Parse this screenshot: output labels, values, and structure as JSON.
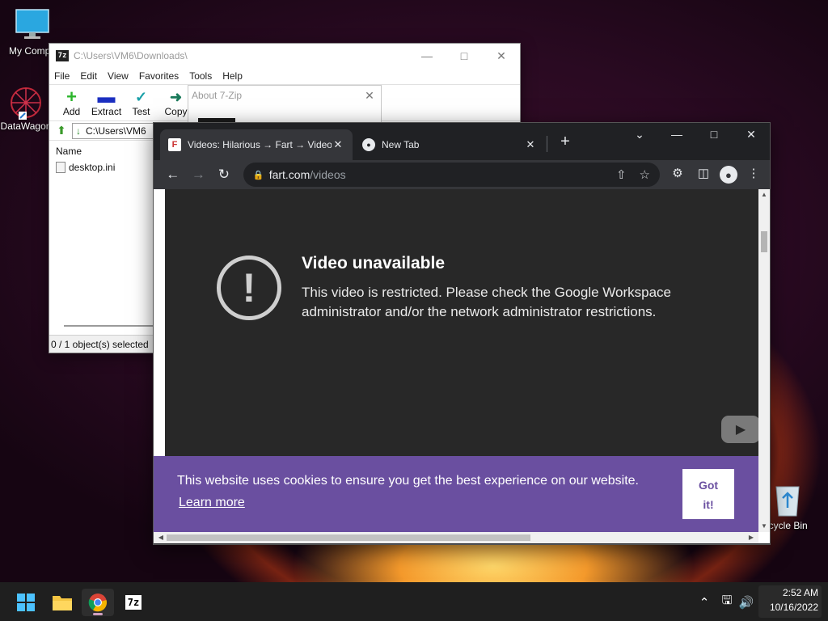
{
  "desktop": {
    "icons": [
      {
        "label": "My Compu",
        "icon": "monitor-icon"
      },
      {
        "label": "DataWagon",
        "icon": "datawagon-icon"
      },
      {
        "label": "ecycle Bin",
        "icon": "recycle-bin-icon"
      }
    ]
  },
  "zip_window": {
    "title": "C:\\Users\\VM6\\Downloads\\",
    "app_icon_text": "7z",
    "menu": [
      "File",
      "Edit",
      "View",
      "Favorites",
      "Tools",
      "Help"
    ],
    "toolbar": [
      {
        "label": "Add",
        "icon": "add-icon"
      },
      {
        "label": "Extract",
        "icon": "extract-icon"
      },
      {
        "label": "Test",
        "icon": "test-icon"
      },
      {
        "label": "Copy",
        "icon": "copy-icon"
      }
    ],
    "address": "C:\\Users\\VM6",
    "column_name": "Name",
    "files": [
      {
        "name": "desktop.ini"
      }
    ],
    "status": "0 / 1 object(s) selected"
  },
  "about_dialog": {
    "title": "About 7-Zip"
  },
  "chrome": {
    "tabs": [
      {
        "title": "Videos: Hilarious → Fart → Video",
        "favicon_text": "F",
        "active": true
      },
      {
        "title": "New Tab",
        "favicon_text": "●",
        "active": false
      }
    ],
    "url_host": "fart.com",
    "url_path": "/videos",
    "video": {
      "heading": "Video unavailable",
      "message": "This video is restricted. Please check the Google Workspace administrator and/or the network administrator restrictions."
    },
    "cookie": {
      "message": "This website uses cookies to ensure you get the best experience on our website.",
      "learn_more": "Learn more",
      "accept_line1": "Got",
      "accept_line2": "it!"
    },
    "colors": {
      "cookie_bg": "#6a4fa0",
      "video_bg": "#282828"
    }
  },
  "taskbar": {
    "apps": [
      "start-icon",
      "file-explorer-icon",
      "chrome-icon",
      "7zip-icon"
    ],
    "taskbar_7z_text": "7z",
    "time": "2:52 AM",
    "date": "10/16/2022"
  }
}
